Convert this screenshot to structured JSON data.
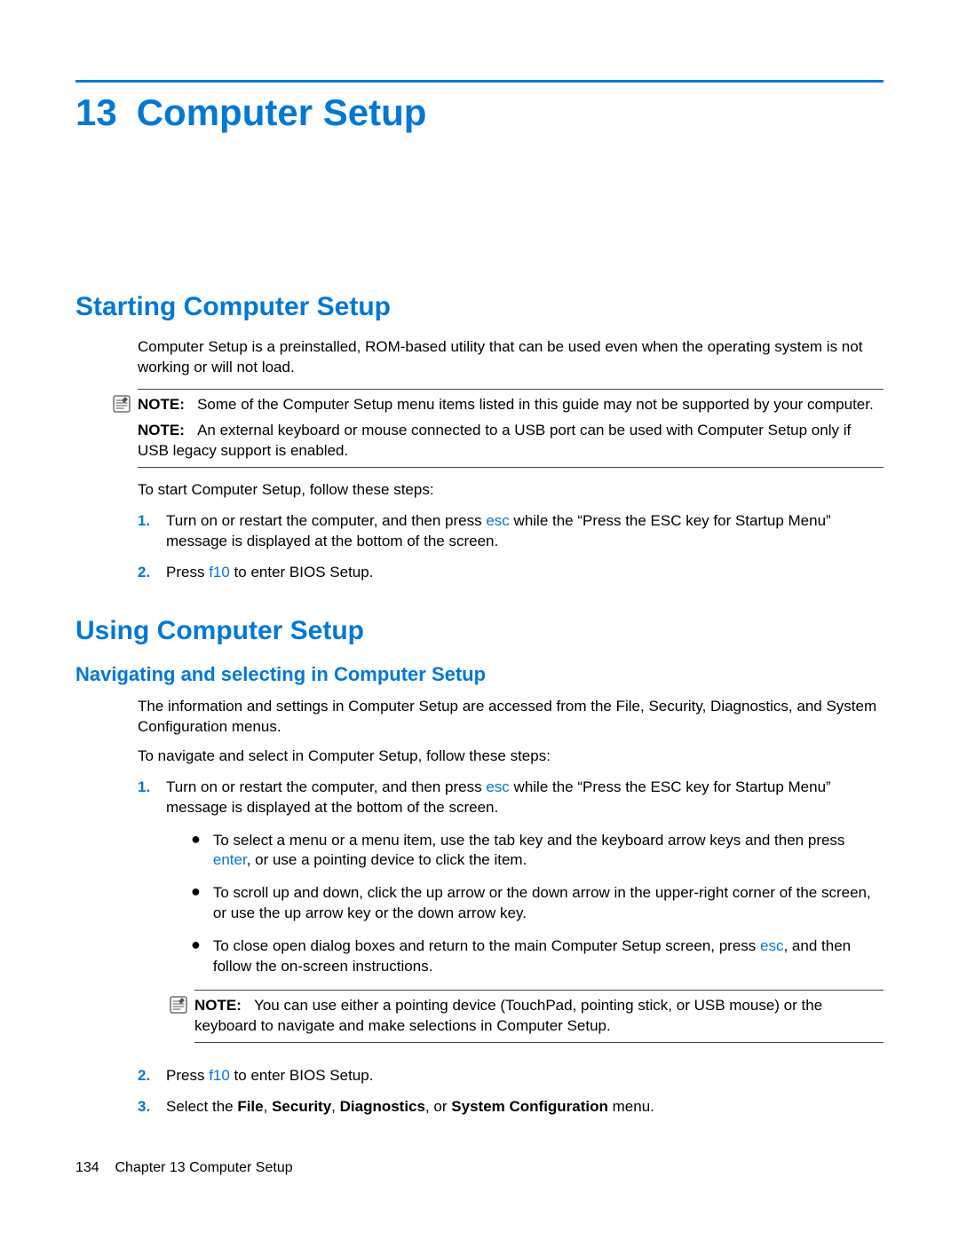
{
  "chapter": {
    "number": "13",
    "title": "Computer Setup"
  },
  "section1": {
    "heading": "Starting Computer Setup",
    "intro": "Computer Setup is a preinstalled, ROM-based utility that can be used even when the operating system is not working or will not load.",
    "note1": {
      "label": "NOTE:",
      "text": "Some of the Computer Setup menu items listed in this guide may not be supported by your computer."
    },
    "note2": {
      "label": "NOTE:",
      "text": "An external keyboard or mouse connected to a USB port can be used with Computer Setup only if USB legacy support is enabled."
    },
    "lead": "To start Computer Setup, follow these steps:",
    "steps": {
      "s1": {
        "num": "1.",
        "pre": "Turn on or restart the computer, and then press ",
        "key": "esc",
        "post": " while the “Press the ESC key for Startup Menu” message is displayed at the bottom of the screen."
      },
      "s2": {
        "num": "2.",
        "pre": "Press ",
        "key": "f10",
        "post": " to enter BIOS Setup."
      }
    }
  },
  "section2": {
    "heading": "Using Computer Setup",
    "sub": {
      "heading": "Navigating and selecting in Computer Setup",
      "p1": "The information and settings in Computer Setup are accessed from the File, Security, Diagnostics, and System Configuration menus.",
      "p2": "To navigate and select in Computer Setup, follow these steps:",
      "s1": {
        "num": "1.",
        "pre": "Turn on or restart the computer, and then press ",
        "key": "esc",
        "post": " while the “Press the ESC key for Startup Menu” message is displayed at the bottom of the screen."
      },
      "bullets": {
        "b1": {
          "pre": "To select a menu or a menu item, use the tab key and the keyboard arrow keys and then press ",
          "key": "enter",
          "post": ", or use a pointing device to click the item."
        },
        "b2": "To scroll up and down, click the up arrow or the down arrow in the upper-right corner of the screen, or use the up arrow key or the down arrow key.",
        "b3": {
          "pre": "To close open dialog boxes and return to the main Computer Setup screen, press ",
          "key": "esc",
          "post": ", and then follow the on-screen instructions."
        }
      },
      "note": {
        "label": "NOTE:",
        "text": "You can use either a pointing device (TouchPad, pointing stick, or USB mouse) or the keyboard to navigate and make selections in Computer Setup."
      },
      "s2": {
        "num": "2.",
        "pre": "Press ",
        "key": "f10",
        "post": " to enter BIOS Setup."
      },
      "s3": {
        "num": "3.",
        "t0": "Select the ",
        "t1": "File",
        "t2": ", ",
        "t3": "Security",
        "t4": ", ",
        "t5": "Diagnostics",
        "t6": ", or ",
        "t7": "System Configuration",
        "t8": " menu."
      }
    }
  },
  "footer": {
    "page": "134",
    "label": "Chapter 13   Computer Setup"
  }
}
